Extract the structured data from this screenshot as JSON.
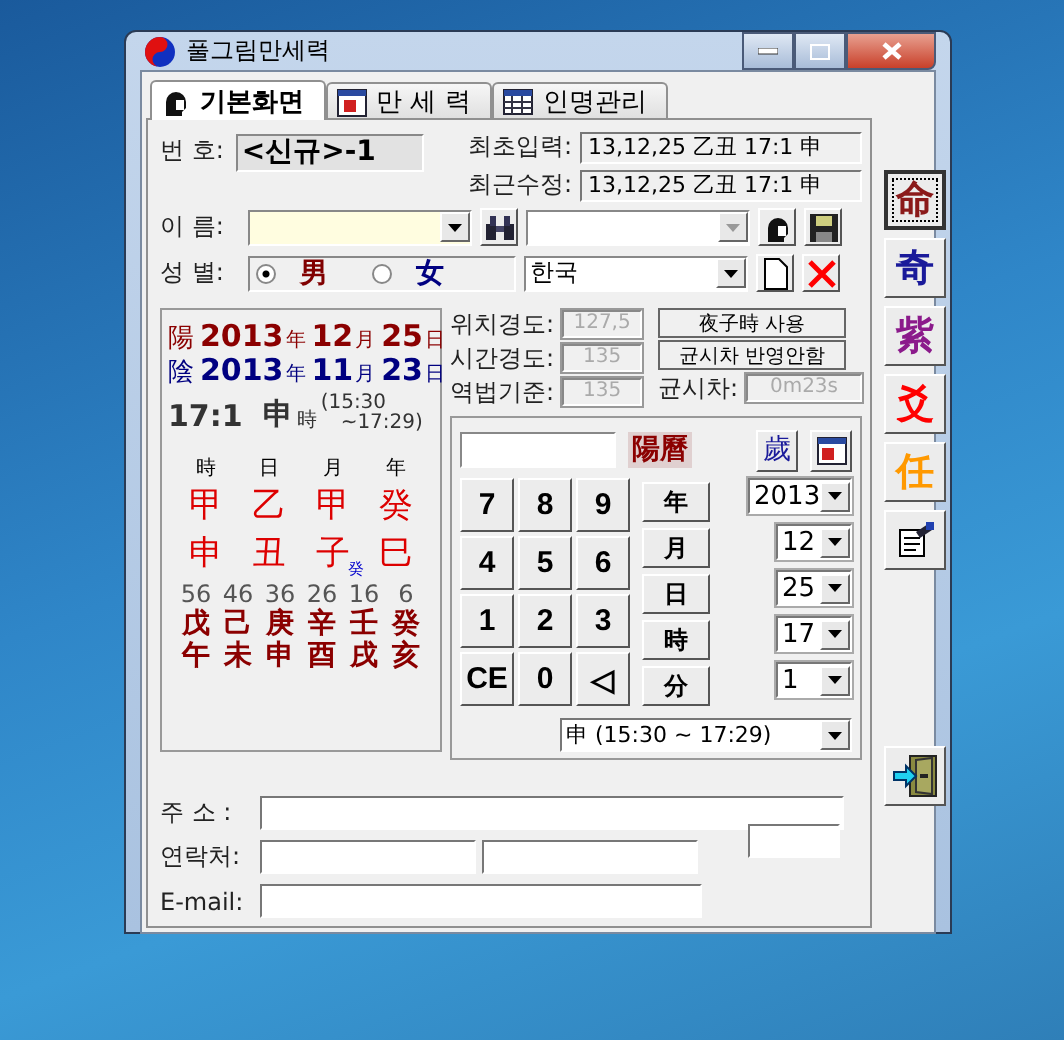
{
  "window": {
    "title": "풀그림만세력"
  },
  "tabs": [
    {
      "label": "기본화면",
      "selected": true,
      "kind": "person"
    },
    {
      "label": "만 세 력",
      "selected": false,
      "kind": "calendar"
    },
    {
      "label": "인명관리",
      "selected": false,
      "kind": "table"
    }
  ],
  "record": {
    "number_label": "번 호:",
    "number": "<신규>-1",
    "first_label": "최초입력:",
    "first": "13,12,25 乙丑 17:1 申",
    "modified_label": "최근수정:",
    "modified": "13,12,25 乙丑 17:1 申"
  },
  "name_label": "이 름:",
  "gender": {
    "label": "성 별:",
    "options": [
      {
        "label": "男",
        "selected": true,
        "color": "#800000"
      },
      {
        "label": "女",
        "selected": false,
        "color": "#000080"
      }
    ]
  },
  "country": "한국",
  "solar": {
    "mark": "陽",
    "year": "2013",
    "year_unit": "年",
    "month": "12",
    "month_unit": "月",
    "day": "25",
    "day_unit": "日"
  },
  "lunar": {
    "mark": "陰",
    "year": "2013",
    "year_unit": "年",
    "month": "11",
    "month_unit": "月",
    "day": "23",
    "day_unit": "日"
  },
  "time": {
    "clock": "17:1",
    "branch": "申",
    "unit": "時",
    "range_start": "(15:30",
    "range_end": "~17:29)"
  },
  "pillars": [
    {
      "header": "時",
      "stem": "甲",
      "branch": "申"
    },
    {
      "header": "日",
      "stem": "乙",
      "branch": "丑"
    },
    {
      "header": "月",
      "stem": "甲",
      "branch": "子",
      "note": "癸"
    },
    {
      "header": "年",
      "stem": "癸",
      "branch": "巳"
    }
  ],
  "cycles": [
    {
      "age": "56",
      "stem": "戊",
      "branch": "午"
    },
    {
      "age": "46",
      "stem": "己",
      "branch": "未"
    },
    {
      "age": "36",
      "stem": "庚",
      "branch": "申"
    },
    {
      "age": "26",
      "stem": "辛",
      "branch": "酉"
    },
    {
      "age": "16",
      "stem": "壬",
      "branch": "戌"
    },
    {
      "age": "6",
      "stem": "癸",
      "branch": "亥"
    }
  ],
  "location": [
    {
      "label": "위치경도:",
      "value": "127,5"
    },
    {
      "label": "시간경도:",
      "value": "135"
    },
    {
      "label": "역법기준:",
      "value": "135"
    }
  ],
  "location_buttons": [
    "夜子時 사용",
    "균시차 반영안함"
  ],
  "eot": {
    "label": "균시차:",
    "value": "0m23s"
  },
  "calc": {
    "mode": "陽曆",
    "year_button": "歲",
    "keys": [
      "7",
      "8",
      "9",
      "4",
      "5",
      "6",
      "1",
      "2",
      "3",
      "CE",
      "0",
      "◁"
    ],
    "units": [
      {
        "label": "年",
        "value": "2013"
      },
      {
        "label": "月",
        "value": "12"
      },
      {
        "label": "日",
        "value": "25"
      },
      {
        "label": "時",
        "value": "17"
      },
      {
        "label": "分",
        "value": "1"
      }
    ],
    "hour_select": "申 (15:30 ~ 17:29)"
  },
  "side": [
    {
      "label": "命",
      "selected": true,
      "color": "#8b1a1a"
    },
    {
      "label": "奇",
      "selected": false,
      "color": "#1a1a9a"
    },
    {
      "label": "紫",
      "selected": false,
      "color": "#8b1a8b"
    },
    {
      "label": "爻",
      "selected": false,
      "color": "#ff0000"
    },
    {
      "label": "任",
      "selected": false,
      "color": "#ff9900"
    }
  ],
  "contact": {
    "address_label": "주 소 :",
    "phone_label": "연락처:",
    "email_label": "E-mail:"
  }
}
